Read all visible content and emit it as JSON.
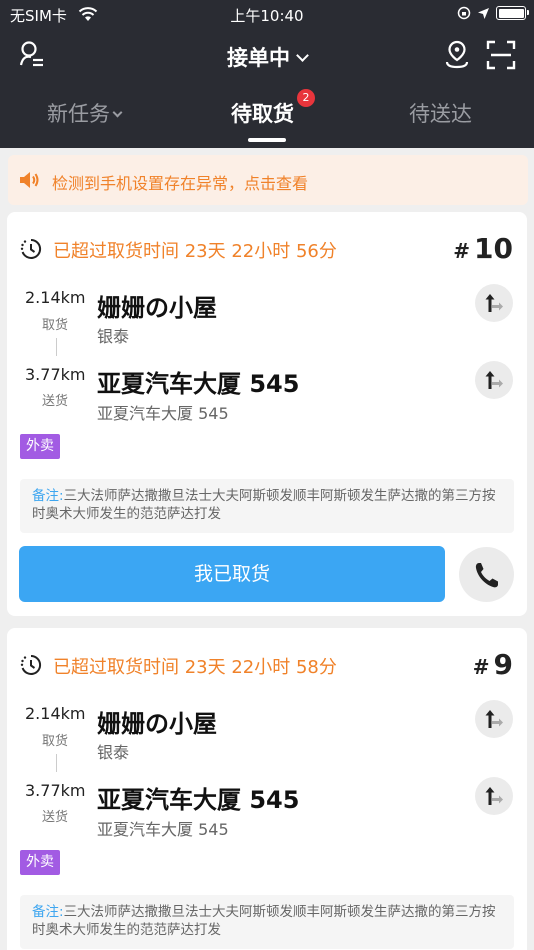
{
  "status_bar": {
    "carrier": "无SIM卡",
    "time": "上午10:40"
  },
  "nav": {
    "title": "接单中"
  },
  "tabs": [
    {
      "label": "新任务"
    },
    {
      "label": "待取货",
      "badge": "2"
    },
    {
      "label": "待送达"
    }
  ],
  "notice": {
    "text": "检测到手机设置存在异常，点击查看"
  },
  "orders": [
    {
      "overdue": "已超过取货时间 23天 22小时 56分",
      "number": "10",
      "pickup": {
        "distance": "2.14km",
        "label": "取货",
        "name": "姗姗の小屋",
        "sub": "银泰"
      },
      "dropoff": {
        "distance": "3.77km",
        "label": "送货",
        "name": "亚夏汽车大厦 545",
        "sub": "亚夏汽车大厦 545"
      },
      "tag": "外卖",
      "note_key": "备注:",
      "note_text": "三大法师萨达撒撒旦法士大夫阿斯顿发顺丰阿斯顿发生萨达撒的第三方按时奥术大师发生的范范萨达打发",
      "action": "我已取货"
    },
    {
      "overdue": "已超过取货时间 23天 22小时 58分",
      "number": "9",
      "pickup": {
        "distance": "2.14km",
        "label": "取货",
        "name": "姗姗の小屋",
        "sub": "银泰"
      },
      "dropoff": {
        "distance": "3.77km",
        "label": "送货",
        "name": "亚夏汽车大厦 545",
        "sub": "亚夏汽车大厦 545"
      },
      "tag": "外卖",
      "note_key": "备注:",
      "note_text": "三大法师萨达撒撒旦法士大夫阿斯顿发顺丰阿斯顿发生萨达撒的第三方按时奥术大师发生的范范萨达打发"
    }
  ],
  "colors": {
    "header": "#2a2c33",
    "accent_orange": "#f0822a",
    "primary_blue": "#3ba6f3",
    "tag_purple": "#a25be3",
    "badge_red": "#e8353c"
  }
}
